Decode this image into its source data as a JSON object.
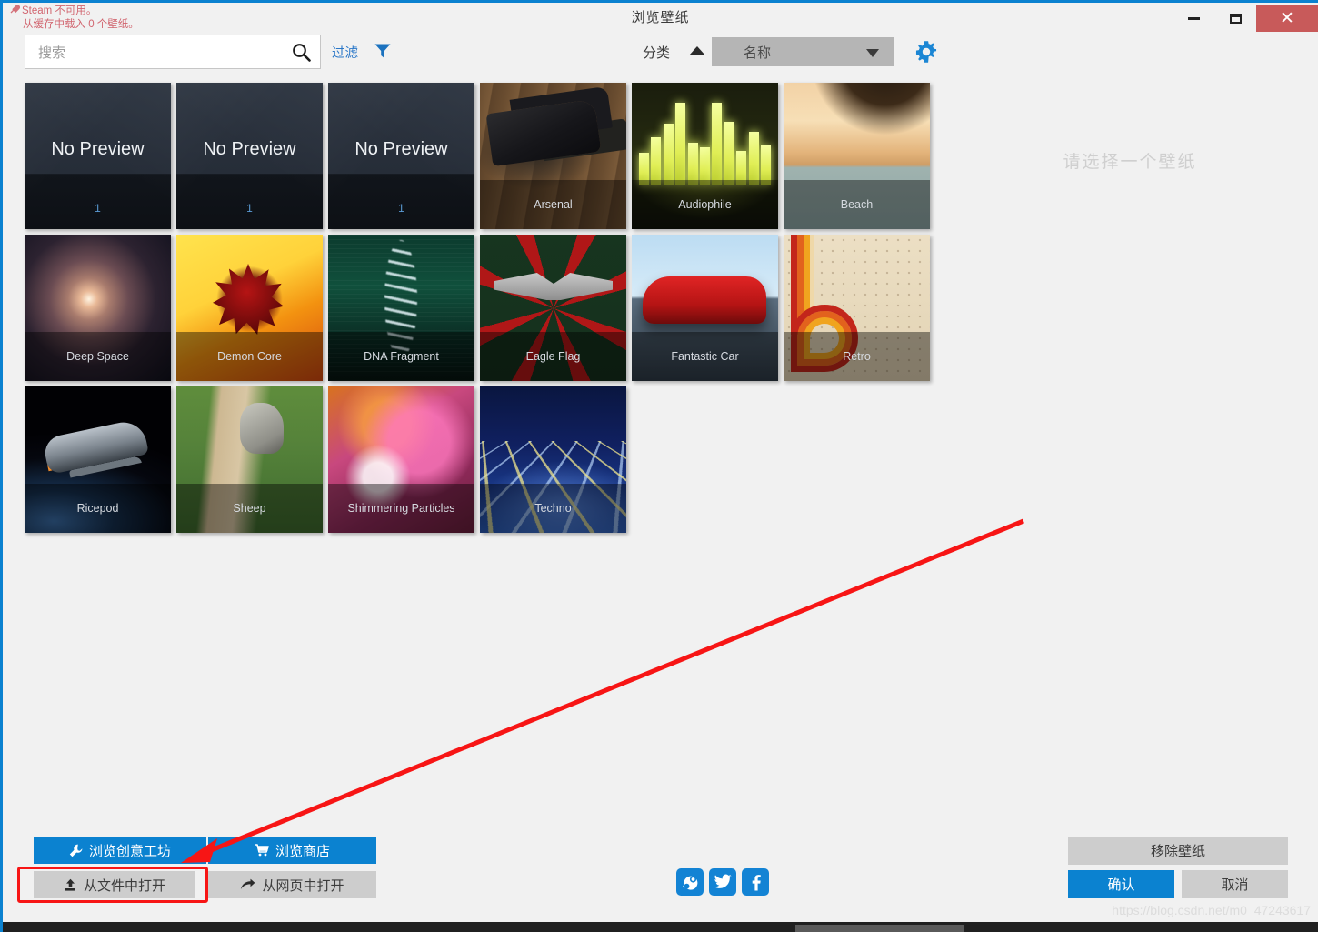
{
  "window": {
    "title": "浏览壁纸",
    "accent_color": "#0b82d0",
    "close_color": "#c85a5a",
    "minimize_label": "最小化",
    "maximize_label": "最大化",
    "close_label": "关闭"
  },
  "status": {
    "line1": "Steam 不可用。",
    "line2": "从缓存中载入 0 个壁纸。",
    "color": "#d1646e"
  },
  "search": {
    "placeholder": "搜索",
    "value": "",
    "filter_label": "过滤"
  },
  "sort": {
    "label": "分类",
    "direction": "ascending",
    "selected": "名称"
  },
  "right_panel": {
    "placeholder": "请选择一个壁纸"
  },
  "tiles": [
    {
      "name": "No Preview",
      "caption": "1",
      "no_preview": true,
      "art": "nopreview"
    },
    {
      "name": "No Preview",
      "caption": "1",
      "no_preview": true,
      "art": "nopreview"
    },
    {
      "name": "No Preview",
      "caption": "1",
      "no_preview": true,
      "art": "nopreview"
    },
    {
      "name": "Arsenal",
      "caption": "Arsenal",
      "no_preview": false,
      "art": "arsenal"
    },
    {
      "name": "Audiophile",
      "caption": "Audiophile",
      "no_preview": false,
      "art": "audiophile"
    },
    {
      "name": "Beach",
      "caption": "Beach",
      "no_preview": false,
      "art": "beach"
    },
    {
      "name": "Deep Space",
      "caption": "Deep Space",
      "no_preview": false,
      "art": "deepspace"
    },
    {
      "name": "Demon Core",
      "caption": "Demon Core",
      "no_preview": false,
      "art": "demoncore"
    },
    {
      "name": "DNA Fragment",
      "caption": "DNA Fragment",
      "no_preview": false,
      "art": "dna"
    },
    {
      "name": "Eagle Flag",
      "caption": "Eagle Flag",
      "no_preview": false,
      "art": "eagle"
    },
    {
      "name": "Fantastic Car",
      "caption": "Fantastic Car",
      "no_preview": false,
      "art": "car"
    },
    {
      "name": "Retro",
      "caption": "Retro",
      "no_preview": false,
      "art": "retro"
    },
    {
      "name": "Ricepod",
      "caption": "Ricepod",
      "no_preview": false,
      "art": "ricepod"
    },
    {
      "name": "Sheep",
      "caption": "Sheep",
      "no_preview": false,
      "art": "sheep"
    },
    {
      "name": "Shimmering Particles",
      "caption": "Shimmering Particles",
      "no_preview": false,
      "art": "shimmer"
    },
    {
      "name": "Techno",
      "caption": "Techno",
      "no_preview": false,
      "art": "techno"
    }
  ],
  "buttons": {
    "workshop": "浏览创意工坊",
    "store": "浏览商店",
    "open_file": "从文件中打开",
    "open_web": "从网页中打开",
    "remove": "移除壁纸",
    "ok": "确认",
    "cancel": "取消"
  },
  "social": [
    {
      "name": "steam",
      "label": "Steam"
    },
    {
      "name": "twitter",
      "label": "Twitter"
    },
    {
      "name": "facebook",
      "label": "Facebook"
    }
  ],
  "annotations": {
    "arrow_color": "#f71515",
    "highlight_color": "#f71515"
  },
  "watermark": "https://blog.csdn.net/m0_47243617"
}
